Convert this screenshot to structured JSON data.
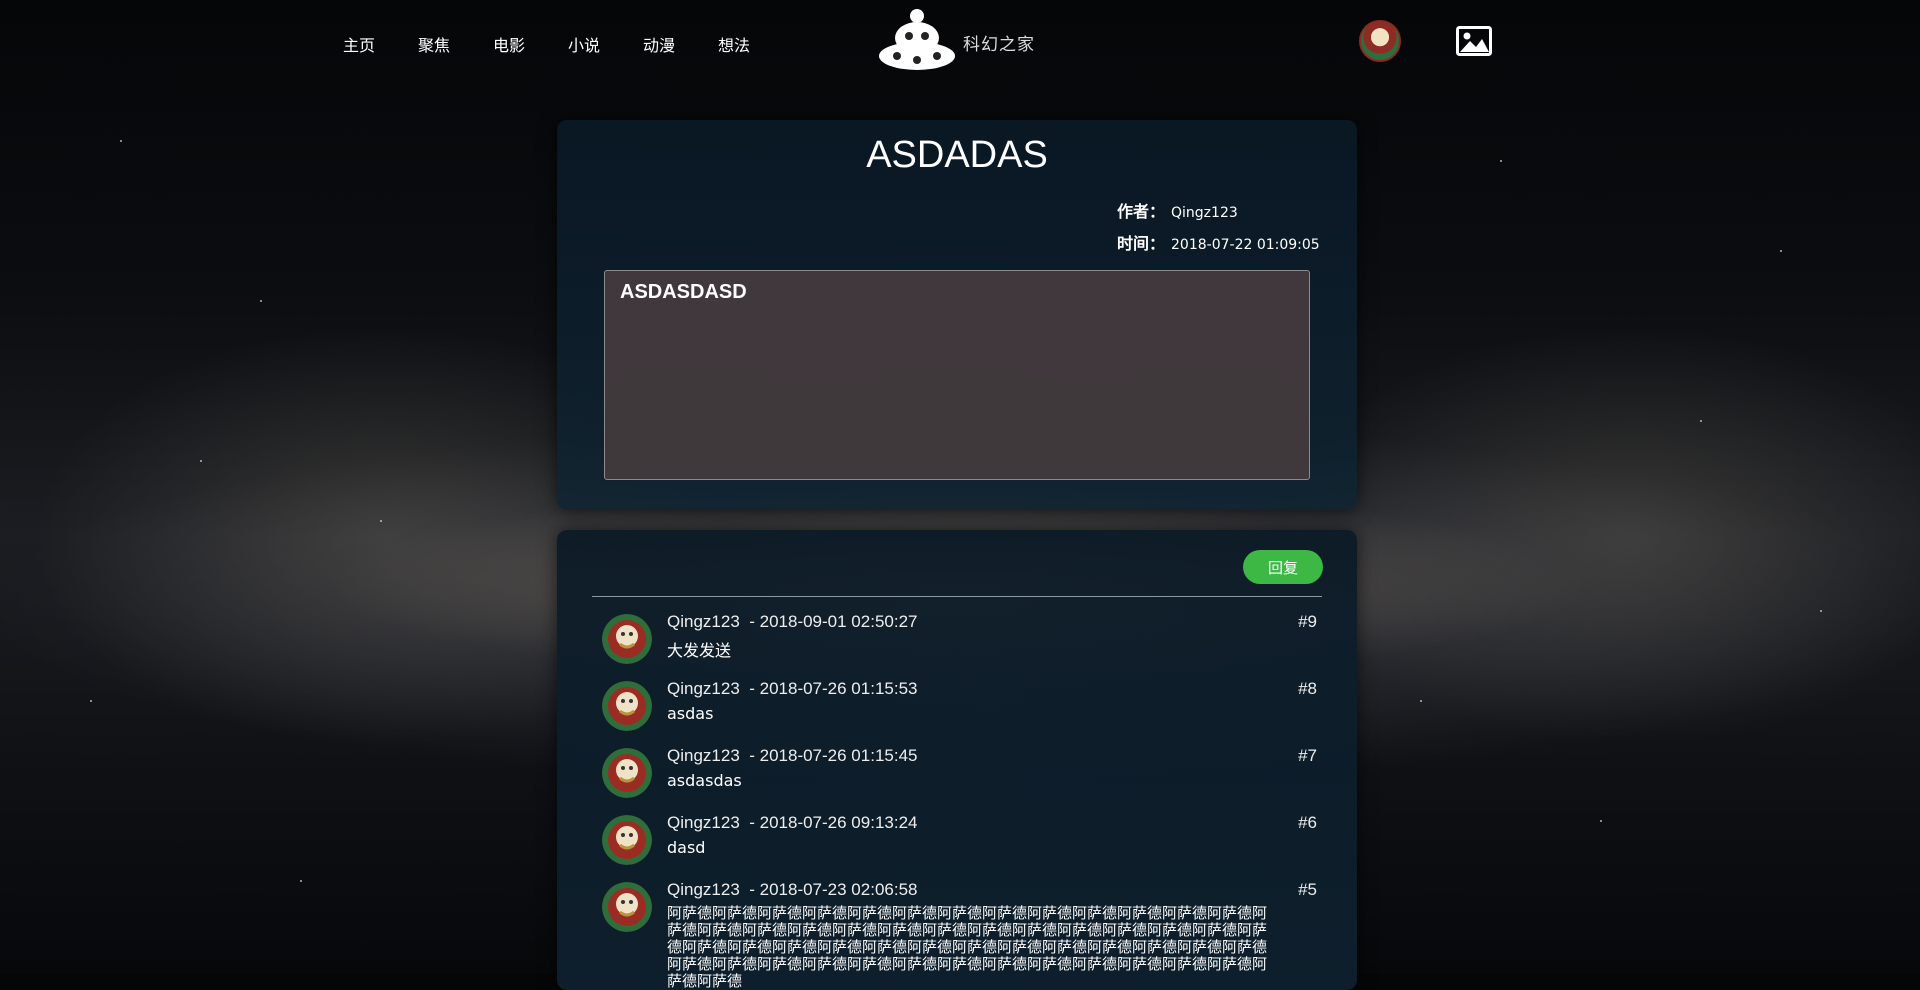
{
  "nav": {
    "items": [
      "主页",
      "聚焦",
      "电影",
      "小说",
      "动漫",
      "想法"
    ],
    "logo_text": "科幻之家"
  },
  "post": {
    "title": "ASDADAS",
    "author_label": "作者：",
    "author": "Qingz123",
    "time_label": "时间：",
    "time": "2018-07-22 01:09:05",
    "content": "ASDASDASD"
  },
  "replies": {
    "button_label": "回复",
    "items": [
      {
        "user": "Qingz123",
        "time": "2018-09-01 02:50:27",
        "num": "#9",
        "text": "大发发送"
      },
      {
        "user": "Qingz123",
        "time": "2018-07-26 01:15:53",
        "num": "#8",
        "text": "asdas"
      },
      {
        "user": "Qingz123",
        "time": "2018-07-26 01:15:45",
        "num": "#7",
        "text": "asdasdas"
      },
      {
        "user": "Qingz123",
        "time": "2018-07-26 09:13:24",
        "num": "#6",
        "text": "dasd"
      },
      {
        "user": "Qingz123",
        "time": "2018-07-23 02:06:58",
        "num": "#5",
        "text": "阿萨德阿萨德阿萨德阿萨德阿萨德阿萨德阿萨德阿萨德阿萨德阿萨德阿萨德阿萨德阿萨德阿萨德阿萨德阿萨德阿萨德阿萨德阿萨德阿萨德阿萨德阿萨德阿萨德阿萨德阿萨德阿萨德阿萨德阿萨德阿萨德阿萨德阿萨德阿萨德阿萨德阿萨德阿萨德阿萨德阿萨德阿萨德阿萨德阿萨德阿萨德阿萨德阿萨德阿萨德阿萨德阿萨德阿萨德阿萨德阿萨德阿萨德阿萨德阿萨德阿萨德阿萨德阿萨德"
      }
    ]
  },
  "colors": {
    "reply_button": "#3db845",
    "card_bg": "#0f2332",
    "content_box_bg": "#463c3e"
  }
}
